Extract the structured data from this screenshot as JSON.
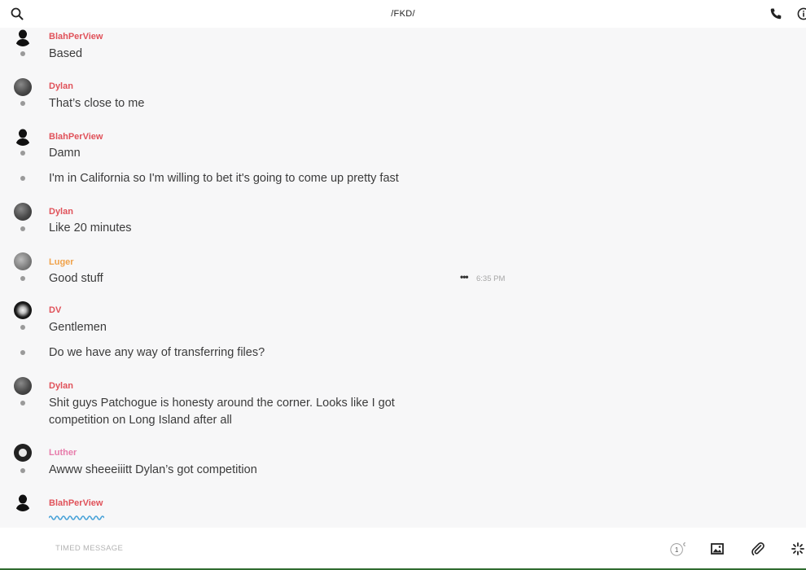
{
  "header": {
    "title": "/FKD/",
    "icons": [
      "search-icon",
      "phone-icon",
      "info-icon"
    ]
  },
  "colors": {
    "name_red": "#e0525a",
    "name_orange": "#f0a24a",
    "name_pink": "#e77cab",
    "typing_blue": "#4aa3d8"
  },
  "messages": [
    {
      "author": "BlahPerView",
      "lines": [
        "Based"
      ]
    },
    {
      "author": "Dylan",
      "lines": [
        "That’s close to me"
      ]
    },
    {
      "author": "BlahPerView",
      "lines": [
        "Damn",
        "I'm in California so I'm willing to bet it's going to come up pretty fast"
      ]
    },
    {
      "author": "Dylan",
      "lines": [
        "Like 20 minutes"
      ]
    },
    {
      "author": "Luger",
      "lines": [
        "Good stuff"
      ],
      "time": "6:35 PM"
    },
    {
      "author": "DV",
      "lines": [
        "Gentlemen",
        "Do we have any way of transferring files?"
      ]
    },
    {
      "author": "Dylan",
      "lines": [
        "Shit guys Patchogue is honesty around the corner. Looks like I got competition on Long Island after all"
      ]
    },
    {
      "author": "Luther",
      "lines": [
        "Awww sheeeiiitt Dylan’s got competition"
      ]
    },
    {
      "author": "BlahPerView",
      "typing": true
    }
  ],
  "composer": {
    "placeholder": "TIMED MESSAGE",
    "timer_value": "1",
    "timer_unit": "d",
    "icons": [
      "timer-icon",
      "image-icon",
      "attachment-icon",
      "sparkle-icon"
    ]
  }
}
